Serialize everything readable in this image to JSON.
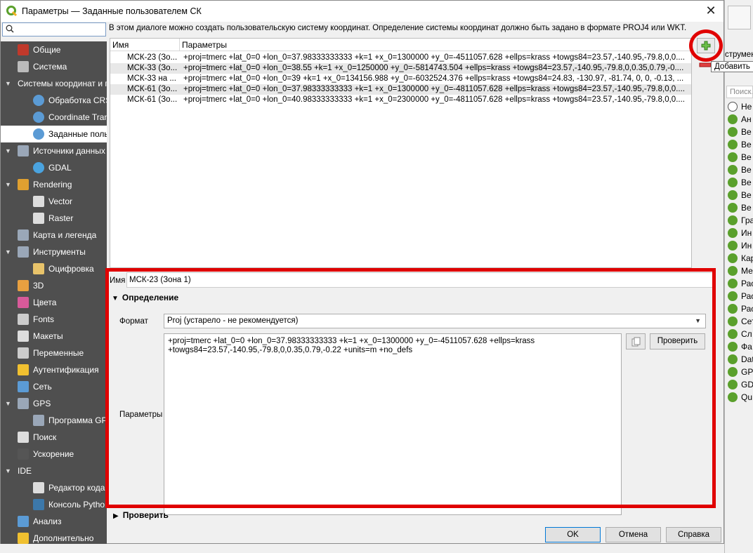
{
  "window": {
    "title": "Параметры — Заданные пользователем СК",
    "close_glyph": "✕"
  },
  "search": {
    "placeholder": ""
  },
  "sidebar": {
    "items": [
      {
        "label": "Общие",
        "level": 0,
        "icon": "tools-icon",
        "color": "#c0392b"
      },
      {
        "label": "Система",
        "level": 0,
        "icon": "gear-icon",
        "color": "#bbbbbb"
      },
      {
        "label": "Системы координат и пр",
        "level": 0,
        "expanded": true,
        "icon": "",
        "color": ""
      },
      {
        "label": "Обработка CRS",
        "level": 1,
        "icon": "globe-icon",
        "color": "#5b9bd5"
      },
      {
        "label": "Coordinate Transf",
        "level": 1,
        "icon": "globe-icon",
        "color": "#5b9bd5"
      },
      {
        "label": "Заданные поль",
        "level": 1,
        "icon": "globe-user-icon",
        "color": "#5b9bd5",
        "selected": true
      },
      {
        "label": "Источники данных",
        "level": 0,
        "expanded": true,
        "icon": "table-icon",
        "color": "#9aa7b8"
      },
      {
        "label": "GDAL",
        "level": 1,
        "icon": "globe-icon",
        "color": "#4aa3df"
      },
      {
        "label": "Rendering",
        "level": 0,
        "expanded": true,
        "icon": "brush-icon",
        "color": "#e0a030"
      },
      {
        "label": "Vector",
        "level": 1,
        "icon": "vector-icon",
        "color": "#dddddd"
      },
      {
        "label": "Raster",
        "level": 1,
        "icon": "raster-icon",
        "color": "#dddddd"
      },
      {
        "label": "Карта и легенда",
        "level": 0,
        "icon": "map-icon",
        "color": "#9aa7b8"
      },
      {
        "label": "Инструменты",
        "level": 0,
        "expanded": true,
        "icon": "toolbox-icon",
        "color": "#9aa7b8"
      },
      {
        "label": "Оцифровка",
        "level": 1,
        "icon": "digitize-icon",
        "color": "#e8c36a"
      },
      {
        "label": "3D",
        "level": 0,
        "icon": "cube-icon",
        "color": "#e8a040"
      },
      {
        "label": "Цвета",
        "level": 0,
        "icon": "colors-icon",
        "color": "#d85a9a"
      },
      {
        "label": "Fonts",
        "level": 0,
        "icon": "font-icon",
        "color": "#cccccc"
      },
      {
        "label": "Макеты",
        "level": 0,
        "icon": "layout-icon",
        "color": "#dddddd"
      },
      {
        "label": "Переменные",
        "level": 0,
        "icon": "variable-icon",
        "color": "#cccccc"
      },
      {
        "label": "Аутентификация",
        "level": 0,
        "icon": "lock-icon",
        "color": "#f0c030"
      },
      {
        "label": "Сеть",
        "level": 0,
        "icon": "network-icon",
        "color": "#5b9bd5"
      },
      {
        "label": "GPS",
        "level": 0,
        "expanded": true,
        "icon": "gps-icon",
        "color": "#9aa7b8"
      },
      {
        "label": "Программа GPS",
        "level": 1,
        "icon": "gps-icon",
        "color": "#9aa7b8"
      },
      {
        "label": "Поиск",
        "level": 0,
        "icon": "search-icon",
        "color": "#dddddd"
      },
      {
        "label": "Ускорение",
        "level": 0,
        "icon": "chip-icon",
        "color": "#555555"
      },
      {
        "label": "IDE",
        "level": 0,
        "expanded": true,
        "icon": "",
        "color": ""
      },
      {
        "label": "Редактор кода",
        "level": 1,
        "icon": "code-editor-icon",
        "color": "#dddddd"
      },
      {
        "label": "Консоль Python",
        "level": 1,
        "icon": "python-icon",
        "color": "#3c78aa"
      },
      {
        "label": "Анализ",
        "level": 0,
        "icon": "analysis-icon",
        "color": "#5b9bd5"
      },
      {
        "label": "Дополнительно",
        "level": 0,
        "icon": "warning-icon",
        "color": "#f0c030"
      }
    ]
  },
  "info_text": "В этом диалоге можно создать пользовательскую систему координат. Определение системы координат должно быть задано в формате PROJ4 или WKT.",
  "table": {
    "columns": [
      "Имя",
      "Параметры"
    ],
    "rows": [
      {
        "name": "МСК-23 (Зо...",
        "params": "+proj=tmerc +lat_0=0 +lon_0=37.98333333333 +k=1 +x_0=1300000 +y_0=-4511057.628 +ellps=krass +towgs84=23.57,-140.95,-79.8,0,0...."
      },
      {
        "name": "МСК-33 (Зо...",
        "params": "+proj=tmerc +lat_0=0 +lon_0=38.55 +k=1 +x_0=1250000 +y_0=-5814743.504 +ellps=krass +towgs84=23.57,-140.95,-79.8,0,0.35,0.79,-0...."
      },
      {
        "name": "МСК-33 на ...",
        "params": "+proj=tmerc +lat_0=0 +lon_0=39 +k=1 +x_0=134156.988 +y_0=-6032524.376 +ellps=krass +towgs84=24.83, -130.97, -81.74, 0, 0, -0.13, ..."
      },
      {
        "name": "МСК-61 (Зо...",
        "params": "+proj=tmerc +lat_0=0 +lon_0=37.98333333333 +k=1 +x_0=1300000 +y_0=-4811057.628 +ellps=krass +towgs84=23.57,-140.95,-79.8,0,0...."
      },
      {
        "name": "МСК-61 (Зо...",
        "params": "+proj=tmerc +lat_0=0 +lon_0=40.98333333333 +k=1 +x_0=2300000 +y_0=-4811057.628 +ellps=krass +towgs84=23.57,-140.95,-79.8,0,0...."
      }
    ]
  },
  "add_tooltip": "Добавить",
  "definition": {
    "name_label": "Имя",
    "name_value": "МСК-23 (Зона 1)",
    "section_title": "Определение",
    "format_label": "Формат",
    "format_value": "Proj (устарело - не рекомендуется)",
    "params_label": "Параметры",
    "params_value": "+proj=tmerc +lat_0=0 +lon_0=37.98333333333 +k=1 +x_0=1300000 +y_0=-4511057.628 +ellps=krass +towgs84=23.57,-140.95,-79.8,0,0.35,0.79,-0.22 +units=m +no_defs",
    "validate_label": "Проверить"
  },
  "check_section": "Проверить",
  "buttons": {
    "ok": "OK",
    "cancel": "Отмена",
    "help": "Справка"
  },
  "behind_panel": {
    "title": "струмен",
    "search_placeholder": "Поиск...",
    "items": [
      "Не",
      "Ан",
      "Ве",
      "Ве",
      "Ве",
      "Ве",
      "Ве",
      "Ве",
      "Ве",
      "Гра",
      "Ин",
      "Ин",
      "Кар",
      "Ме",
      "Рас",
      "Рас",
      "Рас",
      "Сет",
      "Сл",
      "Фа",
      "Dat",
      "GP",
      "GD",
      "Qu"
    ]
  },
  "colors": {
    "highlight": "#e00000",
    "sidebar_bg": "#4f4f4f",
    "qgis_green": "#5aa02c"
  }
}
